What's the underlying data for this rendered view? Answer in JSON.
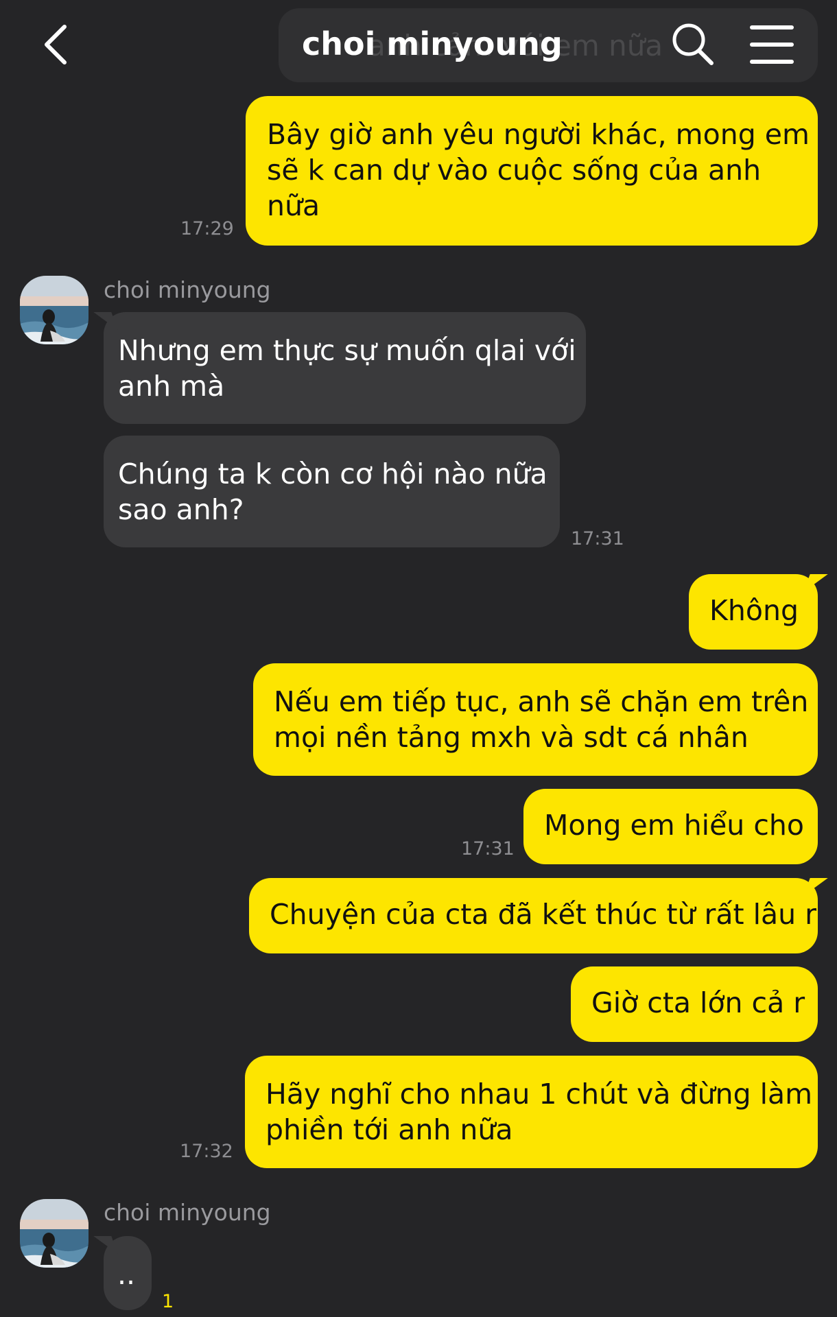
{
  "header": {
    "title": "choi minyoung",
    "ghost_text": "anh cảm với em nữa"
  },
  "messages": {
    "m1": {
      "text": [
        "Bây giờ anh yêu người khác, mong em",
        "sẽ k can dự vào cuộc sống của anh",
        "nữa"
      ],
      "time": "17:29"
    },
    "sender1": "choi minyoung",
    "m2": {
      "text": [
        "Nhưng em thực sự muốn qlai với",
        "anh mà"
      ]
    },
    "m3": {
      "text": [
        "Chúng ta k còn cơ hội nào nữa",
        "sao anh?"
      ],
      "time": "17:31"
    },
    "m4": {
      "text": [
        "Không"
      ]
    },
    "m5": {
      "text": [
        "Nếu em tiếp tục, anh sẽ chặn em trên",
        "mọi nền tảng mxh và sdt cá nhân"
      ]
    },
    "m6": {
      "text": [
        "Mong em hiểu cho"
      ],
      "time": "17:31"
    },
    "m7": {
      "text": [
        "Chuyện của cta đã kết thúc từ rất lâu r"
      ]
    },
    "m8": {
      "text": [
        "Giờ cta lớn cả r"
      ]
    },
    "m9": {
      "text": [
        "Hãy nghĩ cho nhau 1 chút và đừng làm",
        "phiền tới anh nữa"
      ],
      "time": "17:32"
    },
    "sender2": "choi minyoung",
    "m10": {
      "text": [
        ".."
      ],
      "unread": "1"
    }
  },
  "colors": {
    "background": "#252527",
    "outgoing_bubble": "#fde500",
    "incoming_bubble": "#3a3a3c"
  },
  "icons": [
    "back-icon",
    "search-icon",
    "menu-icon"
  ]
}
